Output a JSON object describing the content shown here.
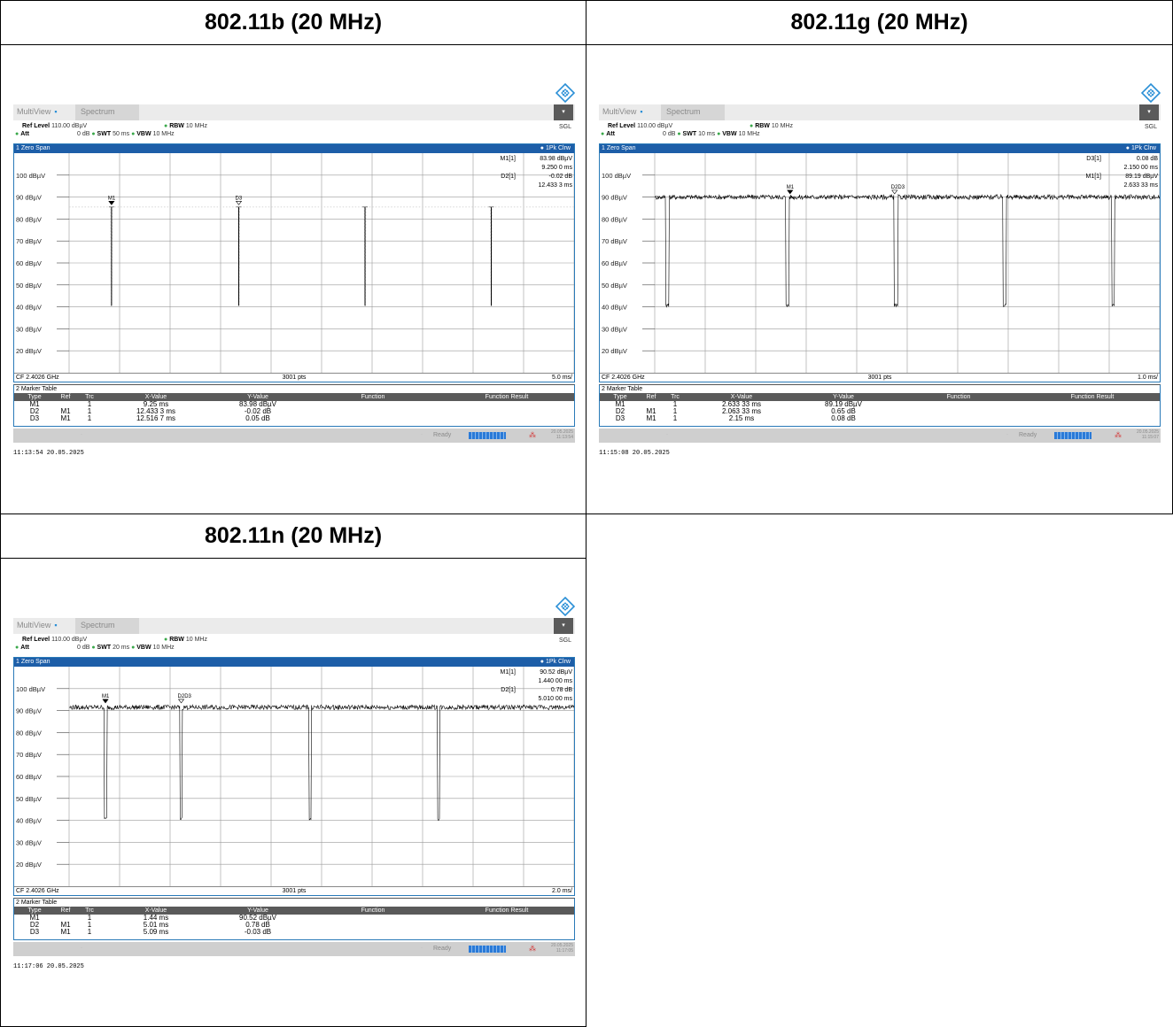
{
  "panels": [
    {
      "title": "802.11b (20 MHz)",
      "tab_multiview": "MultiView",
      "tab_spectrum": "Spectrum",
      "ref_level_label": "Ref Level",
      "ref_level_value": "110.00 dBµV",
      "att_label": "Att",
      "att_value": "0 dB",
      "swt_label": "SWT",
      "swt_value": "50 ms",
      "rbw_label": "RBW",
      "rbw_value": "10 MHz",
      "vbw_label": "VBW",
      "vbw_value": "10 MHz",
      "mode": "SGL",
      "pane_title": "1 Zero Span",
      "trace_label": "1Pk Clrw",
      "readouts": [
        {
          "name": "M1[1]",
          "value": "83.98 dBµV"
        },
        {
          "name": "",
          "value": "9.250 0 ms"
        },
        {
          "name": "D2[1]",
          "value": "-0.02 dB"
        },
        {
          "name": "",
          "value": "12.433 3 ms"
        }
      ],
      "y_ticks": [
        "100 dBµV",
        "90 dBµV",
        "80 dBµV",
        "70 dBµV",
        "60 dBµV",
        "50 dBµV",
        "40 dBµV",
        "30 dBµV",
        "20 dBµV"
      ],
      "cf": "CF 2.4026 GHz",
      "pts": "3001 pts",
      "div": "5.0 ms/",
      "chart_data": {
        "type": "line",
        "ylim": [
          10,
          110
        ],
        "x_divisions": 10,
        "baseline": 85.5,
        "noise": 0,
        "baseline_style": "dotted",
        "dips": [
          {
            "x_div": 0.84,
            "width_div": 0.012,
            "min": 40.5
          },
          {
            "x_div": 3.36,
            "width_div": 0.012,
            "min": 40.5
          },
          {
            "x_div": 5.86,
            "width_div": 0.012,
            "min": 40.5
          },
          {
            "x_div": 8.36,
            "width_div": 0.012,
            "min": 40.5
          }
        ],
        "markers": [
          {
            "label": "M1",
            "x_div": 0.84,
            "y": 86.5,
            "type": "filled"
          },
          {
            "label": "D3",
            "x_div": 3.36,
            "y": 86.5,
            "type": "open"
          }
        ]
      },
      "marker_table_title": "2 Marker Table",
      "mt_headers": [
        "Type",
        "Ref",
        "Trc",
        "X-Value",
        "Y-Value",
        "Function",
        "Function Result"
      ],
      "mt_rows": [
        [
          "M1",
          "",
          "1",
          "9.25 ms",
          "83.98 dBµV",
          "",
          ""
        ],
        [
          "D2",
          "M1",
          "1",
          "12.433 3 ms",
          "-0.02 dB",
          "",
          ""
        ],
        [
          "D3",
          "M1",
          "1",
          "12.516 7 ms",
          "0.05 dB",
          "",
          ""
        ]
      ],
      "status_ready": "Ready",
      "stamp_date": "20.05.2025",
      "stamp_time": "11:13:54",
      "timestamp": "11:13:54  20.05.2025"
    },
    {
      "title": "802.11g (20 MHz)",
      "tab_multiview": "MultiView",
      "tab_spectrum": "Spectrum",
      "ref_level_label": "Ref Level",
      "ref_level_value": "110.00 dBµV",
      "att_label": "Att",
      "att_value": "0 dB",
      "swt_label": "SWT",
      "swt_value": "10 ms",
      "rbw_label": "RBW",
      "rbw_value": "10 MHz",
      "vbw_label": "VBW",
      "vbw_value": "10 MHz",
      "mode": "SGL",
      "pane_title": "1 Zero Span",
      "trace_label": "1Pk Clrw",
      "readouts": [
        {
          "name": "D3[1]",
          "value": "0.08 dB"
        },
        {
          "name": "",
          "value": "2.150 00 ms"
        },
        {
          "name": "M1[1]",
          "value": "89.19 dBµV"
        },
        {
          "name": "",
          "value": "2.633 33 ms"
        }
      ],
      "y_ticks": [
        "100 dBµV",
        "90 dBµV",
        "80 dBµV",
        "70 dBµV",
        "60 dBµV",
        "50 dBµV",
        "40 dBµV",
        "30 dBµV",
        "20 dBµV"
      ],
      "cf": "CF 2.4026 GHz",
      "pts": "3001 pts",
      "div": "1.0 ms/",
      "chart_data": {
        "type": "line",
        "ylim": [
          10,
          110
        ],
        "x_divisions": 10,
        "baseline": 90,
        "noise": 1.1,
        "baseline_style": "noisy",
        "dips": [
          {
            "x_div": 0.25,
            "width_div": 0.06,
            "min": 40
          },
          {
            "x_div": 2.63,
            "width_div": 0.06,
            "min": 40
          },
          {
            "x_div": 4.78,
            "width_div": 0.06,
            "min": 40
          },
          {
            "x_div": 6.93,
            "width_div": 0.06,
            "min": 40
          },
          {
            "x_div": 9.08,
            "width_div": 0.04,
            "min": 40
          }
        ],
        "markers": [
          {
            "label": "M1",
            "x_div": 2.68,
            "y": 91.5,
            "type": "filled"
          },
          {
            "label": "D2D3",
            "x_div": 4.75,
            "y": 91.5,
            "type": "open"
          }
        ]
      },
      "marker_table_title": "2 Marker Table",
      "mt_headers": [
        "Type",
        "Ref",
        "Trc",
        "X-Value",
        "Y-Value",
        "Function",
        "Function Result"
      ],
      "mt_rows": [
        [
          "M1",
          "",
          "1",
          "2.633 33 ms",
          "89.19 dBµV",
          "",
          ""
        ],
        [
          "D2",
          "M1",
          "1",
          "2.063 33 ms",
          "0.65 dB",
          "",
          ""
        ],
        [
          "D3",
          "M1",
          "1",
          "2.15 ms",
          "0.08 dB",
          "",
          ""
        ]
      ],
      "status_ready": "Ready",
      "stamp_date": "20.05.2025",
      "stamp_time": "11:15:07",
      "timestamp": "11:15:08  20.05.2025"
    },
    {
      "title": "802.11n (20 MHz)",
      "tab_multiview": "MultiView",
      "tab_spectrum": "Spectrum",
      "ref_level_label": "Ref Level",
      "ref_level_value": "110.00 dBµV",
      "att_label": "Att",
      "att_value": "0 dB",
      "swt_label": "SWT",
      "swt_value": "20 ms",
      "rbw_label": "RBW",
      "rbw_value": "10 MHz",
      "vbw_label": "VBW",
      "vbw_value": "10 MHz",
      "mode": "SGL",
      "pane_title": "1 Zero Span",
      "trace_label": "1Pk Clrw",
      "readouts": [
        {
          "name": "M1[1]",
          "value": "90.52 dBµV"
        },
        {
          "name": "",
          "value": "1.440 00 ms"
        },
        {
          "name": "D2[1]",
          "value": "0.78 dB"
        },
        {
          "name": "",
          "value": "5.010 00 ms"
        }
      ],
      "y_ticks": [
        "100 dBµV",
        "90 dBµV",
        "80 dBµV",
        "70 dBµV",
        "60 dBµV",
        "50 dBµV",
        "40 dBµV",
        "30 dBµV",
        "20 dBµV"
      ],
      "cf": "CF 2.4026 GHz",
      "pts": "3001 pts",
      "div": "2.0 ms/",
      "chart_data": {
        "type": "line",
        "ylim": [
          10,
          110
        ],
        "x_divisions": 10,
        "baseline": 91.5,
        "noise": 1.1,
        "baseline_style": "noisy",
        "dips": [
          {
            "x_div": 0.72,
            "width_div": 0.04,
            "min": 40
          },
          {
            "x_div": 2.22,
            "width_div": 0.03,
            "min": 40
          },
          {
            "x_div": 4.77,
            "width_div": 0.03,
            "min": 40
          },
          {
            "x_div": 7.32,
            "width_div": 0.03,
            "min": 40
          }
        ],
        "markers": [
          {
            "label": "M1",
            "x_div": 0.72,
            "y": 93.5,
            "type": "filled"
          },
          {
            "label": "D2D3",
            "x_div": 2.22,
            "y": 93.5,
            "type": "open"
          }
        ]
      },
      "marker_table_title": "2 Marker Table",
      "mt_headers": [
        "Type",
        "Ref",
        "Trc",
        "X-Value",
        "Y-Value",
        "Function",
        "Function Result"
      ],
      "mt_rows": [
        [
          "M1",
          "",
          "1",
          "1.44 ms",
          "90.52 dBµV",
          "",
          ""
        ],
        [
          "D2",
          "M1",
          "1",
          "5.01 ms",
          "0.78 dB",
          "",
          ""
        ],
        [
          "D3",
          "M1",
          "1",
          "5.09 ms",
          "-0.03 dB",
          "",
          ""
        ]
      ],
      "status_ready": "Ready",
      "stamp_date": "20.05.2025",
      "stamp_time": "11:17:05",
      "timestamp": "11:17:06  20.05.2025"
    }
  ]
}
